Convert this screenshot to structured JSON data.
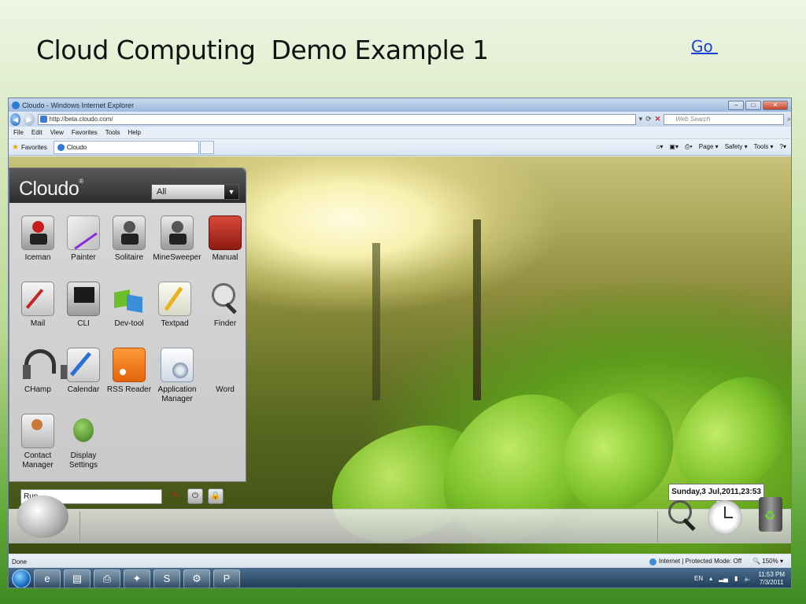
{
  "slide": {
    "title": "Cloud Computing  Demo Example 1",
    "go_link": "Go "
  },
  "browser": {
    "window_title": "Cloudo - Windows Internet Explorer",
    "url": "http://beta.cloudo.com/",
    "search_placeholder": "Web Search",
    "menu": [
      "File",
      "Edit",
      "View",
      "Favorites",
      "Tools",
      "Help"
    ],
    "favorites_label": "Favorites",
    "tab_title": "Cloudo",
    "commands": [
      "Page ▾",
      "Safety ▾",
      "Tools ▾"
    ],
    "status_left": "Done",
    "status_zone": "Internet | Protected Mode: Off",
    "zoom": "150%"
  },
  "cloudo": {
    "logo": "Cloudo",
    "category_select": "All",
    "apps": [
      {
        "label": "Iceman",
        "icon": "joystick-red-icon"
      },
      {
        "label": "Painter",
        "icon": "paintbrush-icon"
      },
      {
        "label": "Solitaire",
        "icon": "joystick-gray-icon"
      },
      {
        "label": "MineSweeper",
        "icon": "joystick-gray-icon"
      },
      {
        "label": "Manual",
        "icon": "manual-book-icon"
      },
      {
        "label": "Mail",
        "icon": "mail-icon"
      },
      {
        "label": "CLI",
        "icon": "terminal-icon"
      },
      {
        "label": "Dev-tool",
        "icon": "cubes-icon"
      },
      {
        "label": "Textpad",
        "icon": "notepad-pencil-icon"
      },
      {
        "label": "Finder",
        "icon": "magnifier-icon"
      },
      {
        "label": "CHamp",
        "icon": "headphones-icon"
      },
      {
        "label": "Calendar",
        "icon": "calendar-pen-icon"
      },
      {
        "label": "RSS Reader",
        "icon": "rss-icon"
      },
      {
        "label": "Application Manager",
        "icon": "app-manager-cd-icon"
      },
      {
        "label": "Word",
        "icon": "word-icon"
      },
      {
        "label": "Contact Manager",
        "icon": "contact-card-icon"
      },
      {
        "label": "Display Settings",
        "icon": "display-settings-icon"
      }
    ],
    "run_value": "Run",
    "tooltip": "Sunday,3 Jul,2011,23:53"
  },
  "taskbar": {
    "lang": "EN",
    "time": "11:53 PM",
    "date": "7/3/2011"
  },
  "colors": {
    "link": "#1a3fd6",
    "cloudo_header": "#2c2c2c",
    "taskbar": "#1d3a55"
  }
}
